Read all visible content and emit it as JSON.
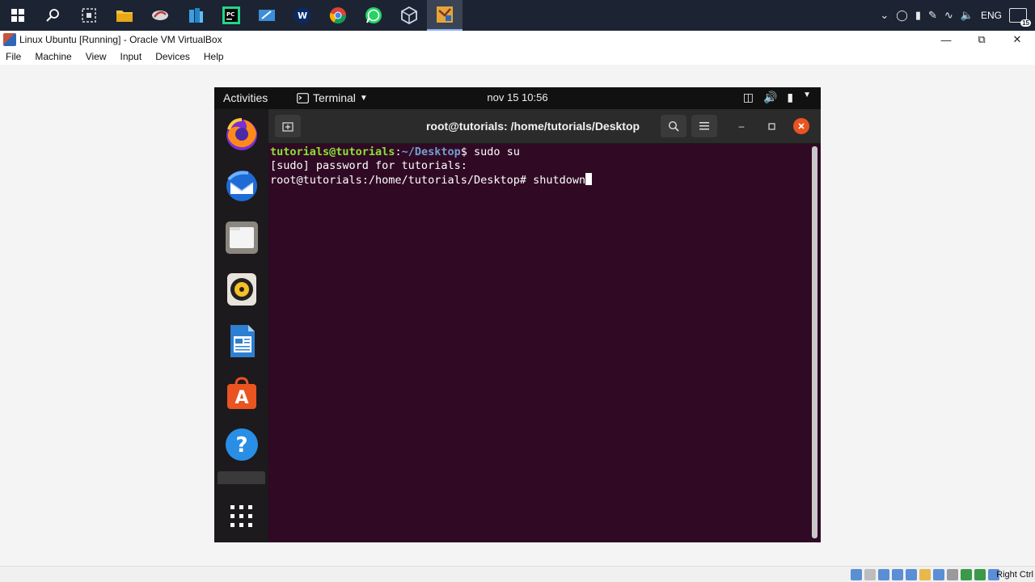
{
  "taskbar": {
    "icons": [
      "windows-start",
      "search",
      "snip",
      "file-explorer",
      "app",
      "app",
      "pycharm",
      "app",
      "app",
      "chrome",
      "whatsapp",
      "virtualbox-app",
      "virtualbox-vm"
    ],
    "tray": {
      "language": "ENG",
      "notification_count": "15"
    }
  },
  "vbox": {
    "title": "Linux Ubuntu [Running] - Oracle VM VirtualBox",
    "menu": [
      "File",
      "Machine",
      "View",
      "Input",
      "Devices",
      "Help"
    ],
    "host_key": "Right Ctrl"
  },
  "gnome": {
    "activities": "Activities",
    "app_menu": "Terminal",
    "clock": "nov 15  10:56"
  },
  "terminal": {
    "title": "root@tutorials: /home/tutorials/Desktop",
    "lines": {
      "l1_user": "tutorials@tutorials",
      "l1_sep": ":",
      "l1_path": "~/Desktop",
      "l1_cmd": "$ sudo su",
      "l2": "[sudo] password for tutorials:",
      "l3_prompt": "root@tutorials:/home/tutorials/Desktop# ",
      "l3_cmd": "shutdown"
    }
  },
  "colors": {
    "terminal_bg": "#300a24",
    "prompt_user": "#8ae234",
    "prompt_path": "#729fcf",
    "close_button": "#e95420"
  }
}
